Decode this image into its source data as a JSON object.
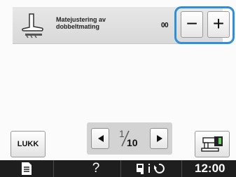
{
  "setting": {
    "label_line1": "Matejustering av",
    "label_line2": "dobbeltmating",
    "value": "00",
    "icon": "presser-foot-icon"
  },
  "adjust": {
    "minus_label": "−",
    "plus_label": "+",
    "highlight_color": "#2f8fdc"
  },
  "footer": {
    "close_label": "LUKK",
    "page_current": "1",
    "page_total": "10",
    "prev_icon": "left-arrow-icon",
    "next_icon": "right-arrow-icon",
    "machine_icon": "sewing-machine-icon"
  },
  "status_bar": {
    "manual_icon": "document-icon",
    "help_label": "?",
    "settings_icon": "settings-icon",
    "time": "12:00"
  }
}
